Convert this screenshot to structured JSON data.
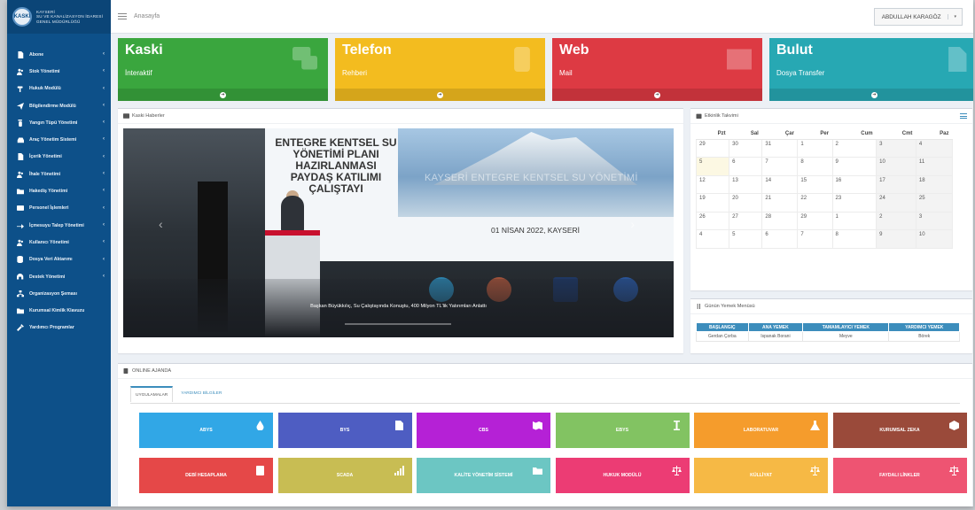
{
  "brand": {
    "logo_text": "KASKİ",
    "line1": "KAYSERİ",
    "line2": "SU VE KANALİZASYON İDARESİ",
    "line3": "GENEL MÜDÜRLÜĞÜ"
  },
  "topbar": {
    "breadcrumb": "Anasayfa",
    "user": "ABDULLAH KARAGÖZ"
  },
  "sidebar": {
    "items": [
      {
        "label": "Abone",
        "icon": "file-icon",
        "chevron": "‹"
      },
      {
        "label": "Stok Yönetimi",
        "icon": "users-icon",
        "chevron": "‹"
      },
      {
        "label": "Hukuk Modülü",
        "icon": "gavel-icon",
        "chevron": "‹"
      },
      {
        "label": "Bilgilendirme Modülü",
        "icon": "send-icon",
        "chevron": "‹"
      },
      {
        "label": "Yangın Tüpü Yönetimi",
        "icon": "extinguisher-icon",
        "chevron": "‹"
      },
      {
        "label": "Araç Yönetim Sistemi",
        "icon": "car-icon",
        "chevron": "‹"
      },
      {
        "label": "İçerik Yönetimi",
        "icon": "file-icon",
        "chevron": "‹"
      },
      {
        "label": "İhale Yönetimi",
        "icon": "users-icon",
        "chevron": "‹"
      },
      {
        "label": "Hakediş Yönetimi",
        "icon": "folder-icon",
        "chevron": "‹"
      },
      {
        "label": "Personel İşlemleri",
        "icon": "id-card-icon",
        "chevron": "‹"
      },
      {
        "label": "İçmesuyu Talep Yönetimi",
        "icon": "share-icon",
        "chevron": "‹"
      },
      {
        "label": "Kullanıcı Yönetimi",
        "icon": "users-icon",
        "chevron": "‹"
      },
      {
        "label": "Dosya Veri Aktarımı",
        "icon": "database-icon",
        "chevron": "‹"
      },
      {
        "label": "Destek Yönetimi",
        "icon": "support-icon",
        "chevron": "‹"
      },
      {
        "label": "Organizasyon Şeması",
        "icon": "sitemap-icon",
        "chevron": ""
      },
      {
        "label": "Kurumsal Kimlik Klavuzu",
        "icon": "folder-icon",
        "chevron": ""
      },
      {
        "label": "Yardımcı Programlar",
        "icon": "tools-icon",
        "chevron": ""
      }
    ]
  },
  "info_boxes": [
    {
      "title": "Kaski",
      "subtitle": "İnteraktif",
      "color": "#3aa63e",
      "icon": "chat-icon"
    },
    {
      "title": "Telefon",
      "subtitle": "Rehberi",
      "color": "#f3bc1f",
      "icon": "phone-icon"
    },
    {
      "title": "Web",
      "subtitle": "Mail",
      "color": "#dd3a43",
      "icon": "mail-icon"
    },
    {
      "title": "Bulut",
      "subtitle": "Dosya Transfer",
      "color": "#27a8b3",
      "icon": "file-icon"
    }
  ],
  "news": {
    "panel_title": "Kaski Haberler",
    "heading": "ENTEGRE KENTSEL SU YÖNETİMİ PLANI HAZIRLANMASI PAYDAŞ KATILIMI ÇALIŞTAYI",
    "overlay_title": "KAYSERİ ENTEGRE KENTSEL SU YÖNETİMİ",
    "date_line": "01 NİSAN 2022, KAYSERİ",
    "caption": "Başkan Büyükkılıç, Su Çalıştayında Konuştu, 400 Milyon TL'lik Yatırımları Anlattı"
  },
  "calendar": {
    "panel_title": "Etkinlik Takvimi",
    "days": [
      "Pzt",
      "Sal",
      "Çar",
      "Per",
      "Cum",
      "Cmt",
      "Paz"
    ],
    "weeks": [
      [
        "29",
        "30",
        "31",
        "1",
        "2",
        "3",
        "4"
      ],
      [
        "5",
        "6",
        "7",
        "8",
        "9",
        "10",
        "11"
      ],
      [
        "12",
        "13",
        "14",
        "15",
        "16",
        "17",
        "18"
      ],
      [
        "19",
        "20",
        "21",
        "22",
        "23",
        "24",
        "25"
      ],
      [
        "26",
        "27",
        "28",
        "29",
        "1",
        "2",
        "3"
      ],
      [
        "4",
        "5",
        "6",
        "7",
        "8",
        "9",
        "10"
      ]
    ]
  },
  "menu": {
    "panel_title": "Günün Yemek Menüsü",
    "headers": [
      "BAŞLANGIÇ",
      "ANA YEMEK",
      "TAMAMLAYICI YEMEK",
      "YARDIMCI YEMEK"
    ],
    "row": [
      "Gerdan Çorba",
      "Ispanak Borani",
      "Meyve",
      "Börek"
    ]
  },
  "agenda": {
    "panel_title": "ONLINE AJANDA",
    "tabs": [
      "UYGULAMALAR",
      "YARDIMCI BİLGİLER"
    ],
    "apps": [
      {
        "label": "ABYS",
        "color": "#31a7e6",
        "icon": "drop-icon"
      },
      {
        "label": "BYS",
        "color": "#4e5dc2",
        "icon": "document-icon"
      },
      {
        "label": "CBS",
        "color": "#b521d6",
        "icon": "map-icon"
      },
      {
        "label": "EBYS",
        "color": "#82c362",
        "icon": "i-beam-icon"
      },
      {
        "label": "LABORATUVAR",
        "color": "#f59c2c",
        "icon": "flask-icon"
      },
      {
        "label": "KURUMSAL ZEKA",
        "color": "#9a4a3a",
        "icon": "cube-icon"
      },
      {
        "label": "DEBİ HESAPLAMA",
        "color": "#e54848",
        "icon": "calculator-icon"
      },
      {
        "label": "SCADA",
        "color": "#c8bd53",
        "icon": "signal-icon"
      },
      {
        "label": "KALİTE YÖNETİM SİSTEMİ",
        "color": "#6cc6c3",
        "icon": "folder-icon"
      },
      {
        "label": "HUKUK MODÜLÜ",
        "color": "#ec3c74",
        "icon": "scale-icon"
      },
      {
        "label": "KÜLLİYAT",
        "color": "#f6b945",
        "icon": "scale-icon"
      },
      {
        "label": "FAYDALI LİNKLER",
        "color": "#ee5472",
        "icon": "scale-icon"
      }
    ]
  }
}
